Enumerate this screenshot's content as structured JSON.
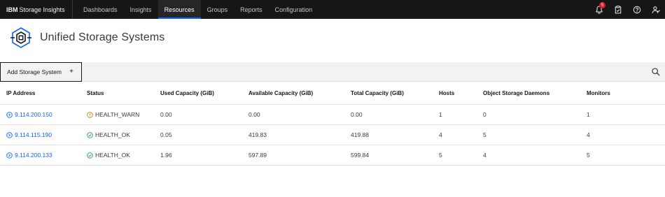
{
  "header": {
    "brand_bold": "IBM",
    "brand_rest": "Storage Insights",
    "nav": [
      {
        "label": "Dashboards"
      },
      {
        "label": "Insights"
      },
      {
        "label": "Resources"
      },
      {
        "label": "Groups"
      },
      {
        "label": "Reports"
      },
      {
        "label": "Configuration"
      }
    ],
    "active_nav": "Resources",
    "notification_count": "5"
  },
  "page": {
    "title": "Unified Storage Systems"
  },
  "toolbar": {
    "add_label": "Add Storage System",
    "add_icon": "+"
  },
  "table": {
    "columns": [
      "IP Address",
      "Status",
      "Used Capacity (GiB)",
      "Available Capacity (GiB)",
      "Total Capacity (GiB)",
      "Hosts",
      "Object Storage Daemons",
      "Monitors"
    ],
    "rows": [
      {
        "ip": "9.114.200.150",
        "status": "HEALTH_WARN",
        "status_kind": "warn",
        "used": "0.00",
        "available": "0.00",
        "total": "0.00",
        "hosts": "1",
        "osd": "0",
        "monitors": "1"
      },
      {
        "ip": "9.114.115.190",
        "status": "HEALTH_OK",
        "status_kind": "ok",
        "used": "0.05",
        "available": "419.83",
        "total": "419.88",
        "hosts": "4",
        "osd": "5",
        "monitors": "4"
      },
      {
        "ip": "9.114.200.133",
        "status": "HEALTH_OK",
        "status_kind": "ok",
        "used": "1.96",
        "available": "597.89",
        "total": "599.84",
        "hosts": "5",
        "osd": "4",
        "monitors": "5"
      }
    ]
  },
  "colors": {
    "accent": "#0f62fe",
    "warn": "#f1c21b",
    "ok": "#24a148",
    "topbar": "#161616",
    "badge": "#da1e28"
  },
  "icons": [
    "bell-icon",
    "clipboard-icon",
    "help-icon",
    "user-icon",
    "storage-system-icon",
    "search-icon",
    "arrow-circle-icon",
    "warning-icon",
    "check-icon"
  ]
}
